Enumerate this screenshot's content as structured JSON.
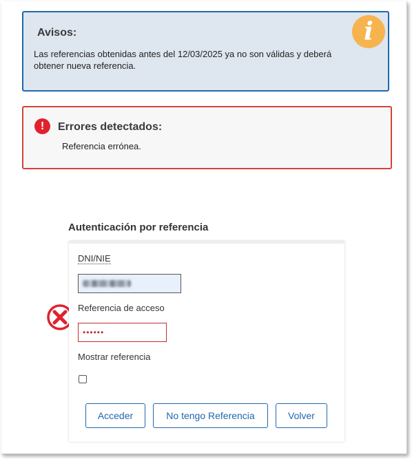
{
  "notice": {
    "title": "Avisos:",
    "text": "Las referencias obtenidas antes del 12/03/2025 ya no son válidas y deberá obtener nueva referencia.",
    "icon": "info-icon",
    "icon_glyph": "i",
    "color": "#1f67ad",
    "icon_color": "#f7b34d"
  },
  "errors": {
    "title": "Errores detectados:",
    "icon": "exclamation-icon",
    "icon_glyph": "!",
    "items": [
      "Referencia errónea."
    ],
    "color": "#d24238"
  },
  "form": {
    "title": "Autenticación por referencia",
    "dni": {
      "label": "DNI/NIE",
      "value": ""
    },
    "referencia": {
      "label": "Referencia de acceso",
      "value": "••••••",
      "error_icon": "cross-circle-icon"
    },
    "mostrar": {
      "label": "Mostrar referencia",
      "checked": false
    },
    "buttons": {
      "acceder": "Acceder",
      "no_tengo": "No tengo Referencia",
      "volver": "Volver"
    }
  }
}
